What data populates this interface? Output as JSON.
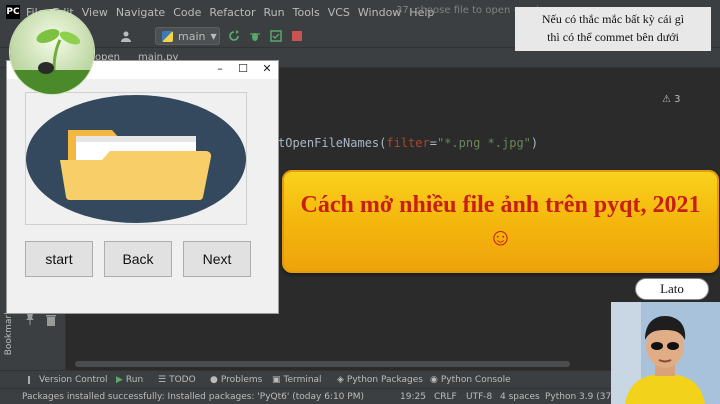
{
  "ide": {
    "menu": [
      "File",
      "Edit",
      "View",
      "Navigate",
      "Code",
      "Refactor",
      "Run",
      "Tools",
      "VCS",
      "Window",
      "Help"
    ],
    "window_title": "37. choose file to open - main.py",
    "run_config": "main",
    "editor_tab": "main.py",
    "project_crumb": "open",
    "code_line": {
      "pre": "tOpenFileNames(",
      "kw": "filter",
      "eq": "=",
      "str": "\"*.png *.jpg\"",
      "post": ")"
    },
    "warning_count": "⚠ 3",
    "side_label": "Bookmarks",
    "bottom_tabs": [
      {
        "label": "Version Control",
        "icon": "branch-icon"
      },
      {
        "label": "Run",
        "icon": "play-icon"
      },
      {
        "label": "TODO",
        "icon": "list-icon"
      },
      {
        "label": "Problems",
        "icon": "info-icon"
      },
      {
        "label": "Terminal",
        "icon": "terminal-icon"
      },
      {
        "label": "Python Packages",
        "icon": "layers-icon"
      },
      {
        "label": "Python Console",
        "icon": "python-icon"
      }
    ],
    "status": {
      "message": "Packages installed successfully: Installed packages: 'PyQt6' (today 6:10 PM)",
      "position": "19:25",
      "line_sep": "CRLF",
      "encoding": "UTF-8",
      "indent": "4 spaces",
      "interpreter": "Python 3.9 (37."
    }
  },
  "dialog": {
    "buttons": {
      "start": "start",
      "back": "Back",
      "next": "Next"
    }
  },
  "overlay": {
    "notice_line1": "Nếu có thắc mắc bất kỳ cái gì",
    "notice_line2": "thì có thể commet bên dưới",
    "banner": "Cách mở nhiều file ảnh trên pyqt, 2021☺",
    "author": "Lato"
  },
  "colors": {
    "ide_bg": "#2b2b2b",
    "panel_bg": "#3c3f41",
    "banner_yellow": "#f6c418",
    "banner_text": "#c81e14"
  }
}
